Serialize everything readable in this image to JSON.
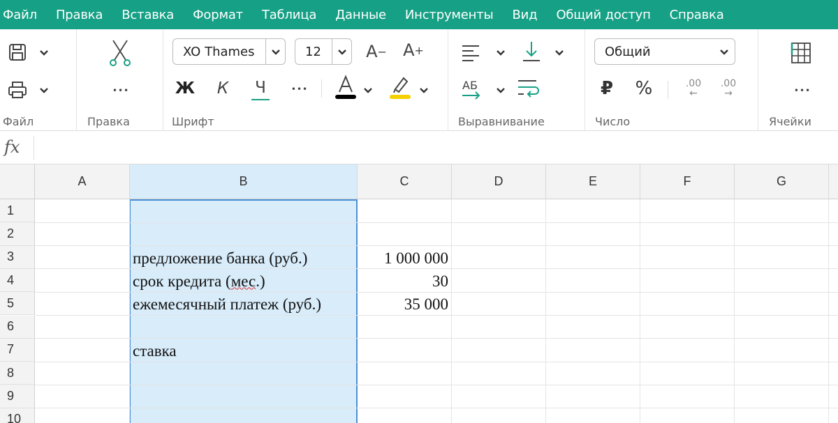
{
  "menu": [
    "Файл",
    "Правка",
    "Вставка",
    "Формат",
    "Таблица",
    "Данные",
    "Инструменты",
    "Вид",
    "Общий доступ",
    "Справка"
  ],
  "ribbon": {
    "groups": {
      "file": "Файл",
      "edit": "Правка",
      "font": "Шрифт",
      "align": "Выравнивание",
      "number": "Число",
      "cells": "Ячейки"
    },
    "font_name": "XO Thames",
    "font_size": "12",
    "grow_font": "A",
    "shrink_font": "A",
    "bold": "Ж",
    "italic": "К",
    "underline": "Ч",
    "more": "•••",
    "number_format": "Общий",
    "currency": "₽",
    "percent": "%",
    "decimals": ".00",
    "highlight_color": "#f5d000",
    "font_color": "#000000"
  },
  "formula_bar": {
    "fx": "fx",
    "value": ""
  },
  "columns": [
    "A",
    "B",
    "C",
    "D",
    "E",
    "F",
    "G"
  ],
  "rows": [
    "1",
    "2",
    "3",
    "4",
    "5",
    "6",
    "7",
    "8",
    "9",
    "10"
  ],
  "cells": {
    "B3": "предложение банка (руб.)",
    "C3": "1 000 000",
    "B4_pre": "срок кредита (",
    "B4_spell": "мес",
    "B4_post": ".)",
    "C4": "30",
    "B5": "ежемесячный платеж (руб.)",
    "C5": "35 000",
    "B7": "ставка"
  },
  "colors": {
    "menu_bg": "#16a085",
    "selection": "#d8ecfa",
    "selection_border": "#4a90d9"
  }
}
